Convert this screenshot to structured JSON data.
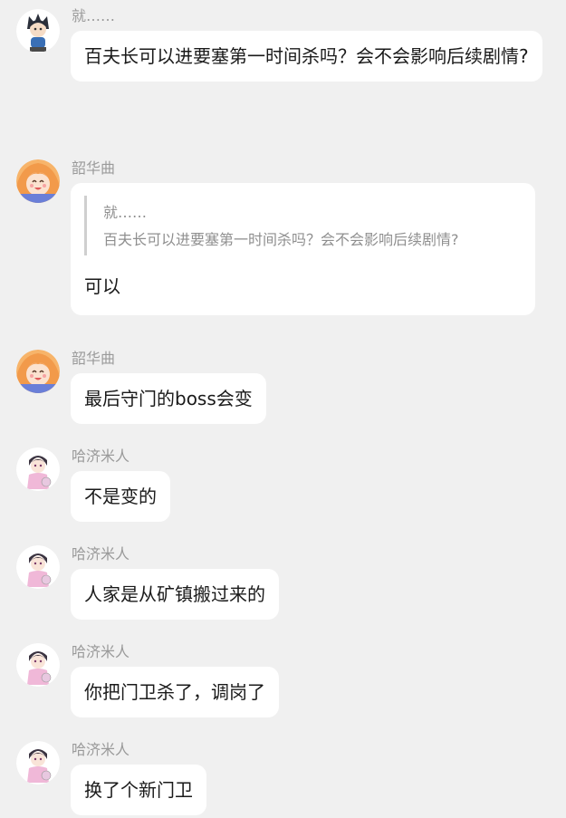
{
  "messages": [
    {
      "sender": "就……",
      "text": "百夫长可以进要塞第一时间杀吗？会不会影响后续剧情?",
      "avatar": "anime-boy-blue-shirt-avatar"
    },
    {
      "sender": "韶华曲",
      "quote_sender": "就……",
      "quote_text": "百夫长可以进要塞第一时间杀吗？会不会影响后续剧情?",
      "text": "可以",
      "avatar": "anime-girl-orange-hair-avatar"
    },
    {
      "sender": "韶华曲",
      "text": "最后守门的boss会变",
      "avatar": "anime-girl-orange-hair-avatar"
    },
    {
      "sender": "哈济米人",
      "text": "不是变的",
      "avatar": "chibi-boy-pink-avatar"
    },
    {
      "sender": "哈济米人",
      "text": "人家是从矿镇搬过来的",
      "avatar": "chibi-boy-pink-avatar"
    },
    {
      "sender": "哈济米人",
      "text": "你把门卫杀了，调岗了",
      "avatar": "chibi-boy-pink-avatar"
    },
    {
      "sender": "哈济米人",
      "text": "换了个新门卫",
      "avatar": "chibi-boy-pink-avatar"
    }
  ],
  "colors": {
    "background": "#f0f0f0",
    "bubble": "#ffffff",
    "sender_name": "#9a9a9a",
    "quote_bar": "#cfcfcf"
  }
}
